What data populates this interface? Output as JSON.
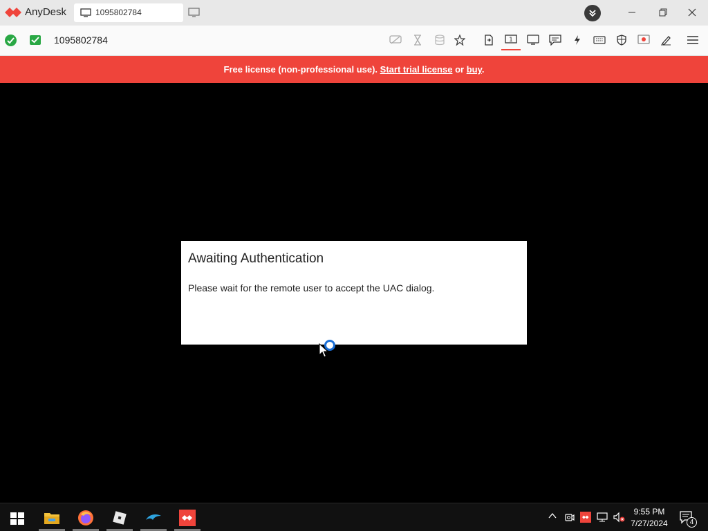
{
  "app": {
    "name": "AnyDesk",
    "brand_color": "#ef443b"
  },
  "tab": {
    "label": "1095802784",
    "icon": "monitor-icon"
  },
  "toolbar": {
    "address": "1095802784",
    "icons": [
      "chat-disabled-icon",
      "hourglass-icon",
      "database-icon",
      "star-icon",
      "file-transfer-icon",
      "monitor-1-icon",
      "display-icon",
      "chat-icon",
      "lightning-icon",
      "keyboard-icon",
      "shield-icon",
      "record-icon",
      "pen-icon",
      "menu-icon"
    ]
  },
  "banner": {
    "prefix": "Free license (non-professional use).",
    "trial_link": "Start trial license",
    "or": "or",
    "buy_link": "buy",
    "suffix": "."
  },
  "dialog": {
    "title": "Awaiting Authentication",
    "message": "Please wait for the remote user to accept the UAC dialog."
  },
  "taskbar": {
    "apps": [
      "windows-start-icon",
      "file-explorer-icon",
      "firefox-icon",
      "roblox-icon",
      "dolphin-icon",
      "anydesk-icon"
    ],
    "tray_icons": [
      "chevron-up-icon",
      "meet-now-icon",
      "anydesk-tray-icon",
      "network-icon",
      "speaker-muted-icon"
    ],
    "time": "9:55 PM",
    "date": "7/27/2024",
    "notification_count": "4"
  }
}
